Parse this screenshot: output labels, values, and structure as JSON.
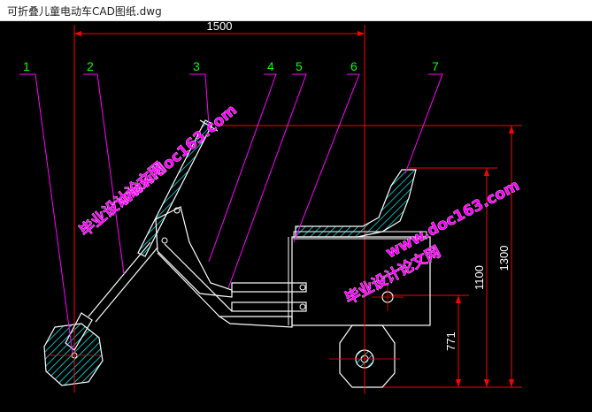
{
  "window": {
    "title": "可折叠儿童电动车CAD图纸.dwg"
  },
  "drawing": {
    "dimensions": {
      "width": "1500",
      "height_total": "1300",
      "height_mid": "1100",
      "height_low": "771"
    },
    "callouts": [
      "1",
      "2",
      "3",
      "4",
      "5",
      "6",
      "7"
    ],
    "watermarks": [
      {
        "site": "www.doc163.com",
        "tagline": "毕业设计论文网"
      },
      {
        "site": "www.doc163.com",
        "tagline": "毕业设计论文网"
      }
    ]
  },
  "colors": {
    "background": "#000000",
    "outline": "#ffffff",
    "dimension": "#ff0000",
    "callout_number": "#00ff00",
    "leader": "#ff00ff",
    "hatch": "#00ffff",
    "watermark": "#ff00ff"
  }
}
